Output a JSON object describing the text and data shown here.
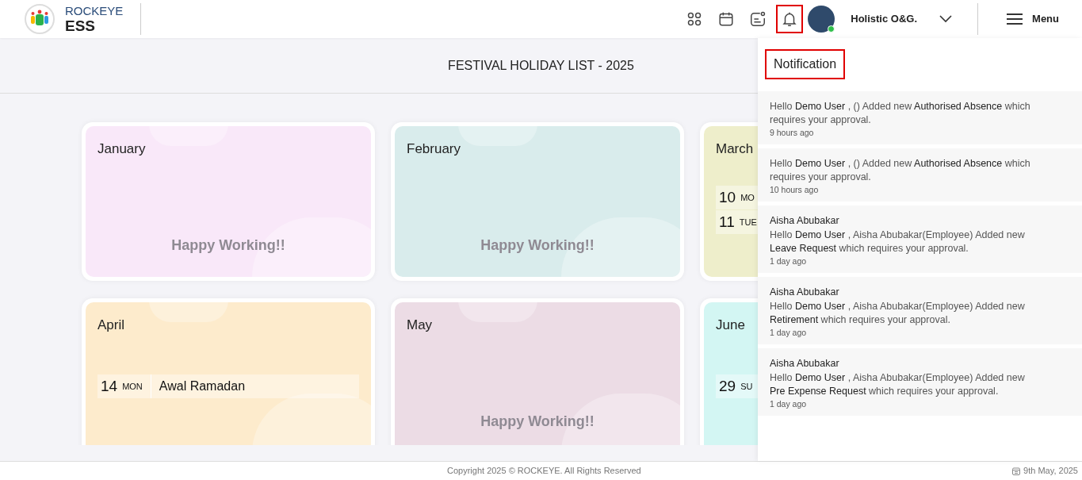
{
  "header": {
    "brand_top": "ROCKEYE",
    "brand_bottom": "ESS",
    "toolbar": [
      {
        "kind": "apps",
        "highlighted": false
      },
      {
        "kind": "calendar",
        "highlighted": false
      },
      {
        "kind": "chat",
        "highlighted": false
      },
      {
        "kind": "bell",
        "highlighted": true
      }
    ],
    "user": {
      "name": "Holistic O&G.",
      "online": true
    },
    "menu_label": "Menu"
  },
  "page_title": "FESTIVAL HOLIDAY LIST - 2025",
  "months": [
    {
      "name": "January",
      "color": "#f9e8f9",
      "empty_text": "Happy Working!!"
    },
    {
      "name": "February",
      "color": "#d9ecec",
      "empty_text": "Happy Working!!"
    },
    {
      "name": "March",
      "color": "#eeeecb",
      "holidays": [
        {
          "day": "10",
          "weekday": "MO"
        },
        {
          "day": "11",
          "weekday": "TUE"
        }
      ]
    },
    {
      "name": "April",
      "color": "#fdebcc",
      "holidays": [
        {
          "day": "14",
          "weekday": "MON",
          "name": "Awal Ramadan"
        }
      ]
    },
    {
      "name": "May",
      "color": "#ecdce5",
      "empty_text": "Happy Working!!"
    },
    {
      "name": "June",
      "color": "#d3f6f3",
      "holidays": [
        {
          "day": "29",
          "weekday": "SU"
        }
      ]
    }
  ],
  "notifications": {
    "title": "Notification",
    "title_highlighted": true,
    "items": [
      {
        "message": "Hello **Demo User** , () Added new **Authorised Absence** which requires your approval.",
        "time": "9 hours ago"
      },
      {
        "message": "Hello **Demo User** , () Added new **Authorised Absence** which requires your approval.",
        "time": "10 hours ago"
      },
      {
        "sender": "Aisha Abubakar",
        "message": "Hello **Demo User** , Aisha Abubakar(Employee) Added new **Leave Request** which requires your approval.",
        "time": "1 day ago"
      },
      {
        "sender": "Aisha Abubakar",
        "message": "Hello **Demo User** , Aisha Abubakar(Employee) Added new **Retirement** which requires your approval.",
        "time": "1 day ago"
      },
      {
        "sender": "Aisha Abubakar",
        "message": "Hello **Demo User** , Aisha Abubakar(Employee) Added new **Pre Expense Request** which requires your approval.",
        "time": "1 day ago"
      }
    ]
  },
  "footer": {
    "copyright": "Copyright 2025 © ROCKEYE. All Rights Reserved",
    "date": "9th May, 2025"
  }
}
